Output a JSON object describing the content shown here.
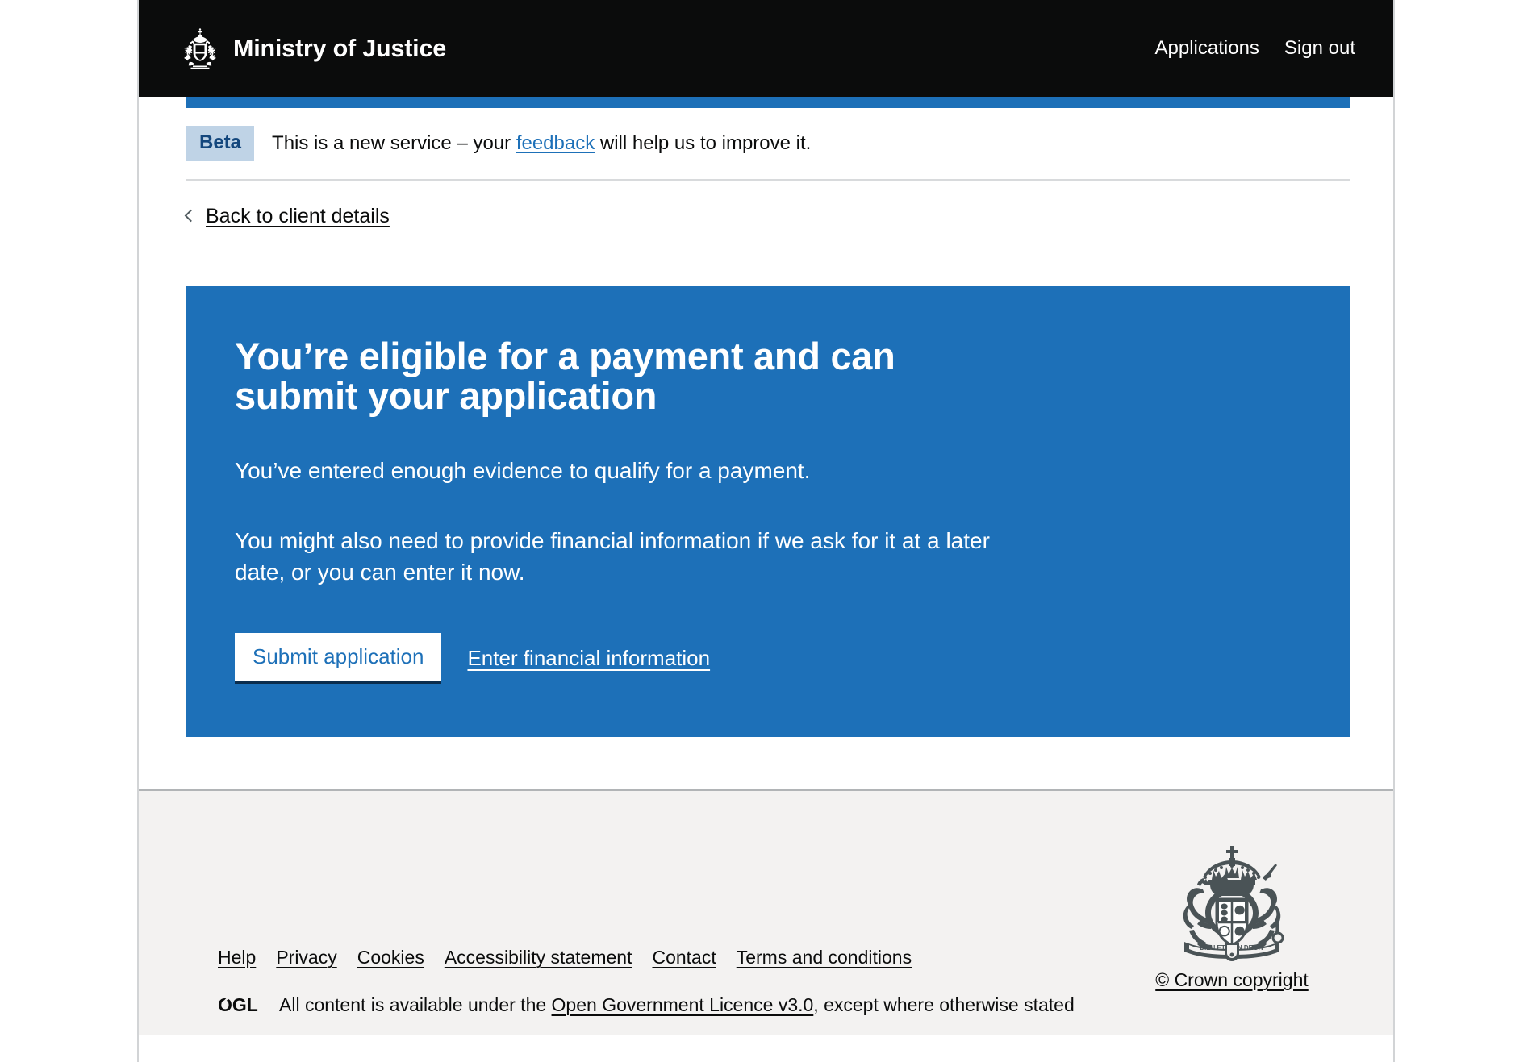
{
  "header": {
    "brand_title": "Ministry of Justice",
    "crest_icon": "royal-crest-icon",
    "nav": [
      {
        "label": "Applications"
      },
      {
        "label": "Sign out"
      }
    ]
  },
  "phase_banner": {
    "tag": "Beta",
    "text_before": "This is a new service – your ",
    "link": "feedback",
    "text_after": " will help us to improve it."
  },
  "back_link": {
    "label": "Back to client details",
    "icon": "chevron-left-icon"
  },
  "panel": {
    "heading": "You’re eligible for a payment and can submit your application",
    "paragraph_1": "You’ve entered enough evidence to qualify for a payment.",
    "paragraph_2": "You might also need to provide financial information if we ask for it at a later date, or you can enter it now.",
    "submit_label": "Submit application",
    "financial_link": "Enter financial information",
    "background_color": "#1d70b8",
    "text_color": "#ffffff"
  },
  "footer": {
    "links": [
      {
        "label": "Help"
      },
      {
        "label": "Privacy"
      },
      {
        "label": "Cookies"
      },
      {
        "label": "Accessibility statement"
      },
      {
        "label": "Contact"
      },
      {
        "label": "Terms and conditions"
      }
    ],
    "ogl_logo": "OGL",
    "licence_before": "All content is available under the ",
    "licence_link": "Open Government Licence v3.0",
    "licence_after": ", except where otherwise stated",
    "crown_copyright": "© Crown copyright",
    "crown_icon": "royal-coat-of-arms-icon",
    "background_color": "#f3f2f1"
  },
  "colors": {
    "header_black": "#0b0c0c",
    "govuk_blue": "#1d70b8",
    "beta_tag_bg": "#bfd3e6",
    "beta_tag_text": "#14477d",
    "footer_bg": "#f3f2f1"
  }
}
